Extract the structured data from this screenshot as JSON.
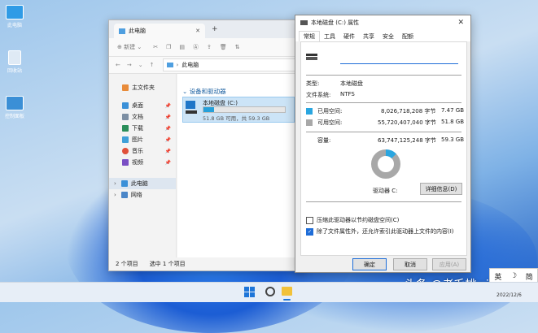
{
  "desktop": {
    "icons": [
      {
        "label": "此电脑"
      },
      {
        "label": "回收站"
      },
      {
        "label": "控制面板"
      }
    ]
  },
  "explorer": {
    "tab_title": "此电脑",
    "new_label": "新建",
    "address": "此电脑",
    "nav_items": [
      {
        "label": "主文件夹"
      },
      {
        "label": "桌面"
      },
      {
        "label": "文档"
      },
      {
        "label": "下载"
      },
      {
        "label": "图片"
      },
      {
        "label": "音乐"
      },
      {
        "label": "视频"
      },
      {
        "label": "此电脑"
      },
      {
        "label": "网络"
      }
    ],
    "group_header": "设备和驱动器",
    "drive": {
      "name": "本地磁盘 (C:)",
      "free_text": "51.8 GB 可用，共 59.3 GB",
      "used_fraction": 0.127
    },
    "status_count": "2 个项目",
    "status_selected": "选中 1 个项目"
  },
  "props": {
    "title": "本地磁盘 (C:) 属性",
    "tabs": [
      "常规",
      "工具",
      "硬件",
      "共享",
      "安全",
      "配额"
    ],
    "label_value": "",
    "type_label": "类型:",
    "type_value": "本地磁盘",
    "fs_label": "文件系统:",
    "fs_value": "NTFS",
    "used_label": "已用空间:",
    "used_bytes": "8,026,718,208 字节",
    "used_gb": "7.47 GB",
    "free_label": "可用空间:",
    "free_bytes": "55,720,407,040 字节",
    "free_gb": "51.8 GB",
    "cap_label": "容量:",
    "cap_bytes": "63,747,125,248 字节",
    "cap_gb": "59.3 GB",
    "drive_label": "驱动器 C:",
    "details_button": "详细信息(D)",
    "compress_label": "压缩此驱动器以节约磁盘空间(C)",
    "index_label": "除了文件属性外，还允许索引此驱动器上文件的内容(I)",
    "ok": "确定",
    "cancel": "取消",
    "apply": "应用(A)",
    "used_color": "#2aa6e0",
    "free_color": "#a8a8a8",
    "used_ratio": 0.126
  },
  "taskbar": {
    "ime_lang": "英",
    "ime_mode": "简",
    "date": "2022/12/6"
  },
  "watermark": "头条 @老毛桃winpe"
}
